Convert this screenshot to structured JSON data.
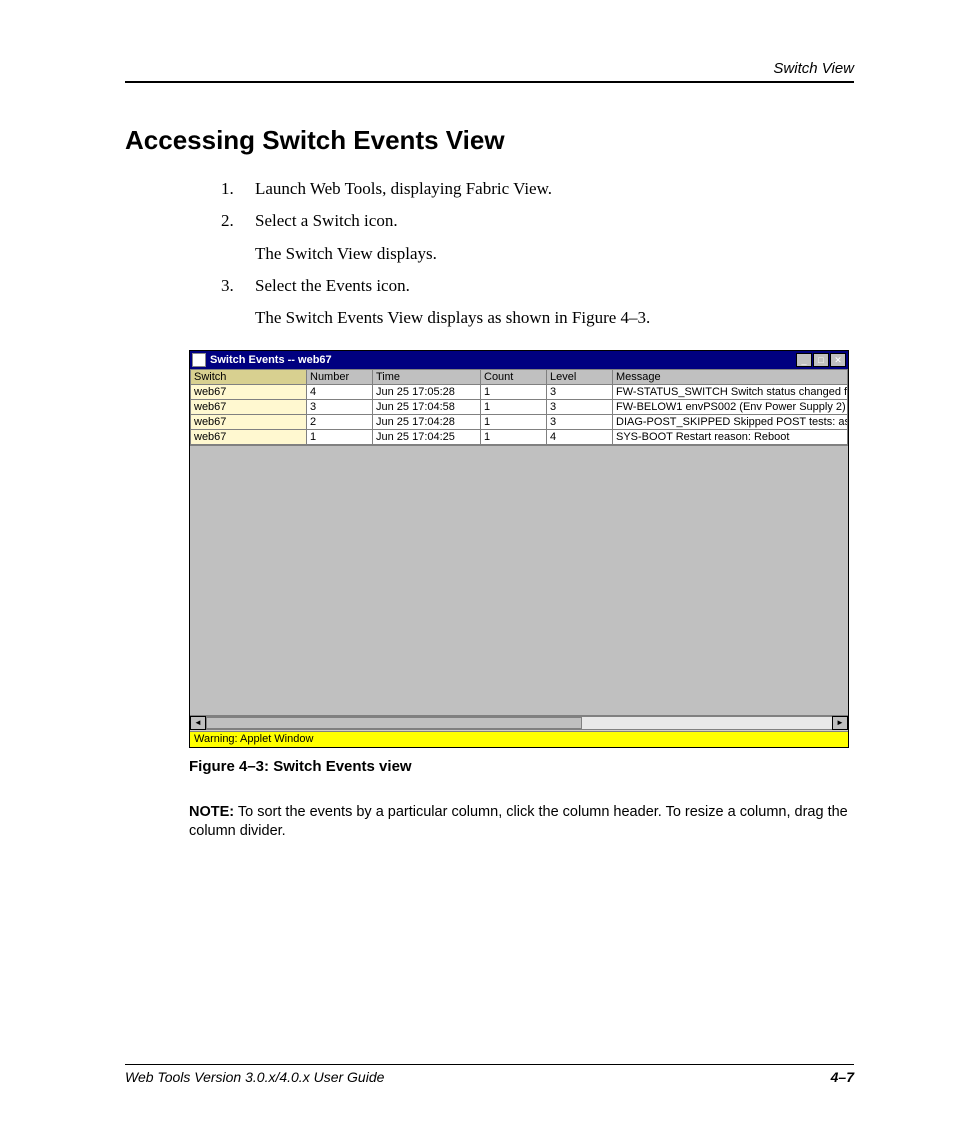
{
  "header": {
    "running": "Switch View"
  },
  "title": "Accessing Switch Events View",
  "steps": [
    {
      "num": "1.",
      "text": "Launch Web Tools, displaying Fabric View."
    },
    {
      "num": "2.",
      "text": "Select a Switch icon.",
      "sub": "The Switch View displays."
    },
    {
      "num": "3.",
      "text": "Select the Events icon.",
      "sub": "The Switch Events View displays as shown in Figure 4–3."
    }
  ],
  "window": {
    "title": "Switch Events -- web67",
    "buttons": {
      "min": "_",
      "max": "□",
      "close": "✕"
    },
    "columns": [
      "Switch",
      "Number",
      "Time",
      "Count",
      "Level",
      "Message"
    ],
    "rows": [
      {
        "switch": "web67",
        "number": "4",
        "time": "Jun 25 17:05:28",
        "count": "1",
        "level": "3",
        "message": "FW-STATUS_SWITCH Switch status changed f"
      },
      {
        "switch": "web67",
        "number": "3",
        "time": "Jun 25 17:04:58",
        "count": "1",
        "level": "3",
        "message": "FW-BELOW1 envPS002 (Env Power Supply 2) i"
      },
      {
        "switch": "web67",
        "number": "2",
        "time": "Jun 25 17:04:28",
        "count": "1",
        "level": "3",
        "message": "DIAG-POST_SKIPPED  Skipped POST tests: as"
      },
      {
        "switch": "web67",
        "number": "1",
        "time": "Jun 25 17:04:25",
        "count": "1",
        "level": "4",
        "message": "SYS-BOOT Restart reason: Reboot"
      }
    ],
    "scroll": {
      "left": "◄",
      "right": "►"
    },
    "status": "Warning: Applet Window"
  },
  "figure_caption": "Figure 4–3:  Switch Events view",
  "note": {
    "label": "NOTE:",
    "text": "  To sort the events by a particular column, click the column header. To resize a column, drag the column divider."
  },
  "footer": {
    "left": "Web Tools Version 3.0.x/4.0.x User Guide",
    "right": "4–7"
  }
}
